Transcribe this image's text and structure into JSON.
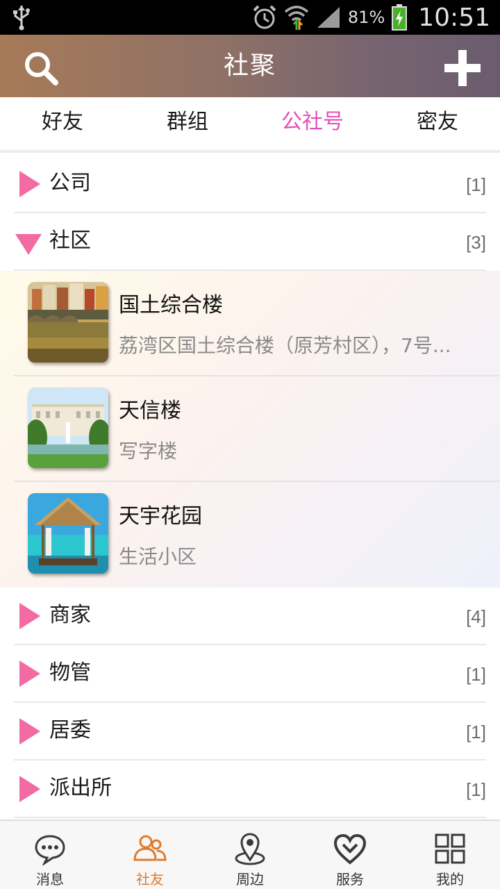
{
  "status_bar": {
    "battery_percent": "81%",
    "time": "10:51",
    "icons": [
      "usb-icon",
      "alarm-icon",
      "wifi-icon",
      "signal-icon",
      "battery-icon"
    ]
  },
  "header": {
    "title": "社聚",
    "search_icon": "search-icon",
    "add_icon": "plus-icon"
  },
  "tabs": [
    {
      "label": "好友",
      "active": false
    },
    {
      "label": "群组",
      "active": false
    },
    {
      "label": "公社号",
      "active": true
    },
    {
      "label": "密友",
      "active": false
    }
  ],
  "groups": [
    {
      "label": "公司",
      "count": "[1]",
      "expanded": false
    },
    {
      "label": "社区",
      "count": "[3]",
      "expanded": true,
      "items": [
        {
          "name": "国土综合楼",
          "desc": "荔湾区国土综合楼（原芳村区），7号...",
          "thumb": "bridge-town-photo"
        },
        {
          "name": "天信楼",
          "desc": "写字楼",
          "thumb": "palace-fountain-photo"
        },
        {
          "name": "天宇花园",
          "desc": "生活小区",
          "thumb": "beach-hut-photo"
        }
      ]
    },
    {
      "label": "商家",
      "count": "[4]",
      "expanded": false
    },
    {
      "label": "物管",
      "count": "[1]",
      "expanded": false
    },
    {
      "label": "居委",
      "count": "[1]",
      "expanded": false
    },
    {
      "label": "派出所",
      "count": "[1]",
      "expanded": false
    }
  ],
  "bottom_nav": [
    {
      "label": "消息",
      "icon": "chat-bubble-icon",
      "active": false
    },
    {
      "label": "社友",
      "icon": "friends-icon",
      "active": true
    },
    {
      "label": "周边",
      "icon": "location-pin-icon",
      "active": false
    },
    {
      "label": "服务",
      "icon": "heart-hands-icon",
      "active": false
    },
    {
      "label": "我的",
      "icon": "grid-icon",
      "active": false
    }
  ],
  "colors": {
    "accent_pink": "#e54fb7",
    "arrow_pink": "#f26ba2",
    "nav_active": "#e07b2a"
  }
}
